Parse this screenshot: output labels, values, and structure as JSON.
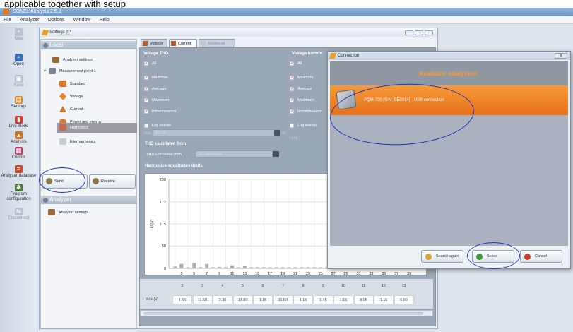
{
  "page_heading": "applicable together with setup",
  "window": {
    "title": "SONEL Analysis 2.5.9"
  },
  "menu": [
    "File",
    "Analyzer",
    "Options",
    "Window",
    "Help"
  ],
  "toolbar": [
    {
      "label": "New",
      "icon": "new-icon",
      "disabled": true
    },
    {
      "label": "Open",
      "icon": "open-icon"
    },
    {
      "label": "Save",
      "icon": "save-icon",
      "disabled": true
    },
    {
      "label": "Settings",
      "icon": "settings-icon"
    },
    {
      "label": "Live mode",
      "icon": "live-mode-icon"
    },
    {
      "label": "Analysis",
      "icon": "analysis-icon"
    },
    {
      "label": "Control",
      "icon": "control-icon"
    },
    {
      "label": "Analyzer database",
      "icon": "database-icon"
    },
    {
      "label": "Program configuration",
      "icon": "configuration-icon"
    },
    {
      "label": "Disconnect",
      "icon": "disconnect-icon",
      "disabled": true
    }
  ],
  "settings_window": {
    "title": "Settings [!]*"
  },
  "left_panel": {
    "local_header": "Local",
    "analyzer_header": "Analyzer",
    "tree": [
      {
        "label": "Analyzer settings",
        "level": 1
      },
      {
        "label": "Measurement point 1",
        "level": 1
      },
      {
        "label": "Standard",
        "level": 2
      },
      {
        "label": "Voltage",
        "level": 2
      },
      {
        "label": "Current",
        "level": 2
      },
      {
        "label": "Power and energy",
        "level": 2
      },
      {
        "label": "Harmonics",
        "level": 2,
        "selected": true
      },
      {
        "label": "Interharmonics",
        "level": 2
      }
    ],
    "analyzer_tree": [
      {
        "label": "Analyzer settings"
      }
    ],
    "send_label": "Send",
    "receive_label": "Receive"
  },
  "tabs": [
    "Voltage",
    "Current",
    "Additional"
  ],
  "voltage_thd": {
    "header": "Voltage THD",
    "checks": [
      {
        "label": "All",
        "checked": true
      },
      {
        "label": "Minimum",
        "checked": true
      },
      {
        "label": "Average",
        "checked": true
      },
      {
        "label": "Maximum",
        "checked": true
      },
      {
        "label": "Instantaneous",
        "checked": true
      },
      {
        "label": "Log events",
        "checked": false
      }
    ],
    "max_label": "Max",
    "max_value": "85.00",
    "unit": "%"
  },
  "voltage_harmonics": {
    "header": "Voltage harmor",
    "checks": [
      {
        "label": "All",
        "checked": true
      },
      {
        "label": "Minimum",
        "checked": true
      },
      {
        "label": "Average",
        "checked": true
      },
      {
        "label": "Maximum",
        "checked": true
      },
      {
        "label": "Instantaneous",
        "checked": true
      },
      {
        "label": "Log events",
        "checked": false
      }
    ],
    "limit_label": "Limit"
  },
  "thd_calc": {
    "header": "THD calculated from",
    "label": "THD calculated from",
    "value": "40 harmonics"
  },
  "harmonics_limits": {
    "header": "Harmonics amplitudes limits"
  },
  "chart_data": {
    "type": "bar",
    "title": "Harmonics amplitudes limits",
    "ylabel": "U [V]",
    "ylim": [
      0,
      230
    ],
    "yticks": [
      0,
      58,
      115,
      172,
      230
    ],
    "categories": [
      "2",
      "3",
      "4",
      "5",
      "6",
      "7",
      "8",
      "9",
      "10",
      "11",
      "12",
      "13",
      "14",
      "15",
      "16",
      "17",
      "18",
      "19",
      "20",
      "21",
      "22",
      "23",
      "24",
      "25",
      "26",
      "27",
      "28",
      "29",
      "30",
      "31",
      "32",
      "33",
      "34",
      "35",
      "36",
      "37",
      "38",
      "39",
      "40"
    ],
    "x_tick_labels": [
      "3",
      "5",
      "7",
      "9",
      "11",
      "13",
      "15",
      "17",
      "19",
      "21",
      "23",
      "25",
      "27",
      "29",
      "31",
      "33",
      "35",
      "37",
      "39"
    ],
    "values": [
      4.6,
      11.5,
      2.3,
      13.8,
      1.15,
      11.5,
      1.15,
      3.45,
      1.15,
      8.05,
      1.15,
      6.9,
      1,
      1,
      1,
      1,
      1,
      1,
      1,
      1,
      1,
      1,
      1,
      1,
      1,
      1,
      1,
      1,
      1,
      1,
      1,
      1,
      1,
      1,
      1,
      1,
      1,
      1,
      1
    ]
  },
  "table": {
    "row_label": "Max [V]",
    "headers": [
      "2",
      "3",
      "4",
      "5",
      "6",
      "7",
      "8",
      "9",
      "10",
      "11",
      "12",
      "13"
    ],
    "values": [
      "4.60",
      "11.50",
      "2.30",
      "13.80",
      "1.15",
      "11.50",
      "1.15",
      "3.45",
      "1.15",
      "8.05",
      "1.15",
      "6.90"
    ]
  },
  "dialog": {
    "title": "Connection",
    "header": "Available analyzers:",
    "analyzer": "PQM-700 [S/N: BE0314] - USB connection",
    "search_again": "Search again",
    "select": "Select",
    "cancel": "Cancel",
    "close": "x"
  },
  "colors": {
    "accent_orange": "#f39a34",
    "selected_row": "#e6701a",
    "annotation_blue": "#2038b8"
  }
}
